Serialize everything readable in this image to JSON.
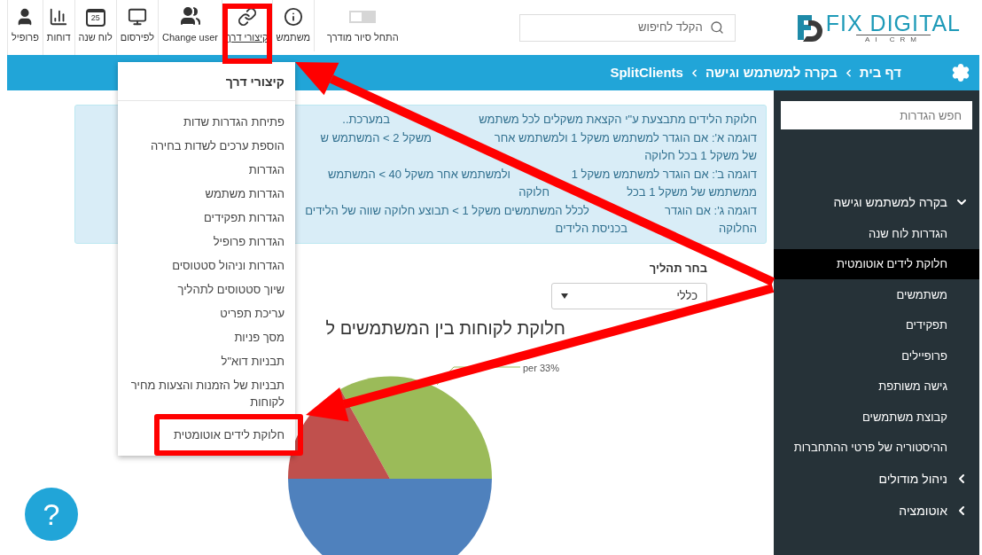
{
  "toolbar": {
    "tour_toggle": {
      "label": "התחל סיור מודרך",
      "on": false
    },
    "items": [
      {
        "label": "משתמש",
        "selected": false,
        "highlighted": false
      },
      {
        "label": "קיצורי דרך",
        "selected": true,
        "highlighted": true
      },
      {
        "label": "Change user",
        "selected": false,
        "highlighted": false
      },
      {
        "label": "לפירסום",
        "selected": false,
        "highlighted": false
      },
      {
        "label": "לוח שנה",
        "day": "25",
        "selected": false,
        "highlighted": false
      },
      {
        "label": "דוחות",
        "selected": false,
        "highlighted": false
      },
      {
        "label": "פרופיל",
        "selected": false,
        "highlighted": false
      }
    ]
  },
  "search": {
    "placeholder": "הקלד לחיפוש"
  },
  "logo": {
    "name": "FIX DIGITAL",
    "tagline": "AI CRM"
  },
  "breadcrumb": [
    "דף בית",
    "בקרה למשתמש וגישה",
    "SplitClients"
  ],
  "info_box": {
    "lines": [
      [
        "חלוקת הלידים מתבצעת ע\"י הקצאת משקלים לכל משתמש",
        "במערכת.."
      ],
      [
        "דוגמה א': אם הוגדר למשתמש משקל 1 ולמשתמש אחר",
        "משקל 2 > המשתמש ש"
      ],
      [
        "של משקל 1 בכל חלוקה"
      ],
      [
        "דוגמה ב': אם הוגדר למשתמש משקל 1",
        "ולמשתמש אחר משקל 40 > המשתמש"
      ],
      [
        "ממשתמש של משקל 1 בכל",
        "חלוקה"
      ],
      [
        "דוגמה ג': אם הוגדר",
        "לכלל המשתמשים משקל 1 > תבוצע חלוקה שווה של הלידים"
      ],
      [
        "החלוקה",
        "בכניסת הלידים"
      ]
    ]
  },
  "process": {
    "label": "בחר תהליך",
    "value": "כללי"
  },
  "chart": {
    "title": "חלוקת לקוחות בין המשתמשים ל",
    "slice_label": "per 33%"
  },
  "help_button": {
    "label": "?"
  },
  "shortcuts_menu": {
    "title": "קיצורי דרך",
    "items": [
      {
        "label": "פתיחת הגדרות שדות",
        "highlighted": false
      },
      {
        "label": "הוספת ערכים לשדות בחירה",
        "highlighted": false
      },
      {
        "label": "הגדרות",
        "highlighted": false
      },
      {
        "label": "הגדרות משתמש",
        "highlighted": false
      },
      {
        "label": "הגדרות תפקידים",
        "highlighted": false
      },
      {
        "label": "הגדרות פרופיל",
        "highlighted": false
      },
      {
        "label": "הגדרות וניהול סטטוסים",
        "highlighted": false
      },
      {
        "label": "שיוך סטטוסים לתהליך",
        "highlighted": false
      },
      {
        "label": "עריכת תפריט",
        "highlighted": false
      },
      {
        "label": "מסך פניות",
        "highlighted": false
      },
      {
        "label": "תבניות דוא\"ל",
        "highlighted": false
      },
      {
        "label": "תבניות של הזמנות והצעות מחיר לקוחות",
        "highlighted": false
      },
      {
        "label": "חלוקת לידים אוטומטית",
        "highlighted": true
      }
    ]
  },
  "sidebar": {
    "search": {
      "placeholder": "חפש הגדרות"
    },
    "groups": [
      {
        "label": "בקרה למשתמש וגישה",
        "expanded": true,
        "children": [
          {
            "label": "הגדרות לוח שנה",
            "selected": false
          },
          {
            "label": "חלוקת לידים אוטומטית",
            "selected": true
          },
          {
            "label": "משתמשים",
            "selected": false
          },
          {
            "label": "תפקידים",
            "selected": false
          },
          {
            "label": "פרופיילים",
            "selected": false
          },
          {
            "label": "גישה משותפת",
            "selected": false
          },
          {
            "label": "קבוצת משתמשים",
            "selected": false
          },
          {
            "label": "ההיסטוריה של פרטי ההתחברות",
            "selected": false
          }
        ]
      },
      {
        "label": "ניהול מודולים",
        "expanded": false
      },
      {
        "label": "אוטומציה",
        "expanded": false
      }
    ]
  }
}
